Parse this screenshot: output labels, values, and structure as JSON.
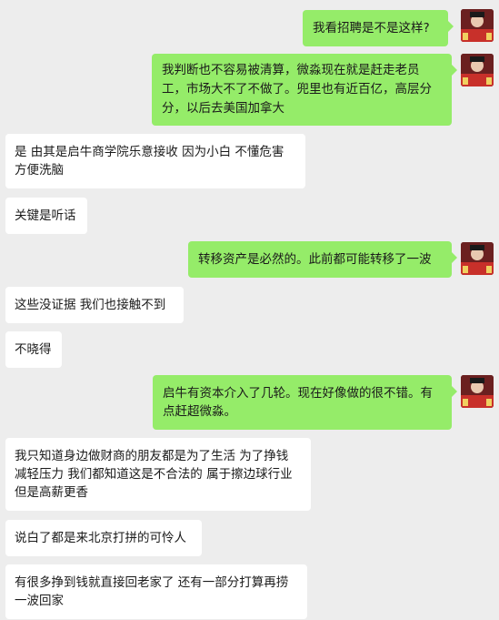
{
  "chat": {
    "messages": [
      {
        "side": "out",
        "text": "我看招聘是不是这样?"
      },
      {
        "side": "out",
        "text": "我判断也不容易被清算，微淼现在就是赶走老员工，市场大不了不做了。兜里也有近百亿，高层分分，以后去美国加拿大"
      },
      {
        "side": "in",
        "text": "是 由其是启牛商学院乐意接收 因为小白 不懂危害 方便洗脑"
      },
      {
        "side": "in",
        "text": "关键是听话"
      },
      {
        "side": "out",
        "text": "转移资产是必然的。此前都可能转移了一波"
      },
      {
        "side": "in",
        "text": "这些没证据 我们也接触不到"
      },
      {
        "side": "in",
        "text": "不晓得"
      },
      {
        "side": "out",
        "text": "启牛有资本介入了几轮。现在好像做的很不错。有点赶超微淼。"
      },
      {
        "side": "in",
        "text": "我只知道身边做财商的朋友都是为了生活 为了挣钱 减轻压力 我们都知道这是不合法的 属于擦边球行业 但是高薪更香"
      },
      {
        "side": "in",
        "text": "说白了都是来北京打拼的可怜人"
      },
      {
        "side": "in",
        "text": "有很多挣到钱就直接回老家了 还有一部分打算再捞一波回家"
      }
    ]
  }
}
